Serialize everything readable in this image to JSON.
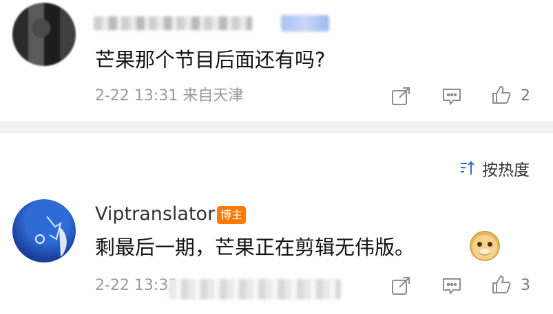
{
  "comments": [
    {
      "text": "芒果那个节目后面还有吗?",
      "timestamp": "2-22 13:31",
      "location": "来自天津",
      "like_count": "2"
    },
    {
      "username": "Viptranslator",
      "badge": "博主",
      "text": "剩最后一期，芒果正在剪辑无伟版。",
      "timestamp": "2-22 13:32",
      "like_count": "3"
    }
  ],
  "sort": {
    "label": "按热度"
  },
  "icons": {
    "share": "share-icon",
    "comment": "comment-icon",
    "like": "thumbs-up-icon",
    "sort": "sort-icon",
    "emoji": "doge-emoji-icon"
  }
}
